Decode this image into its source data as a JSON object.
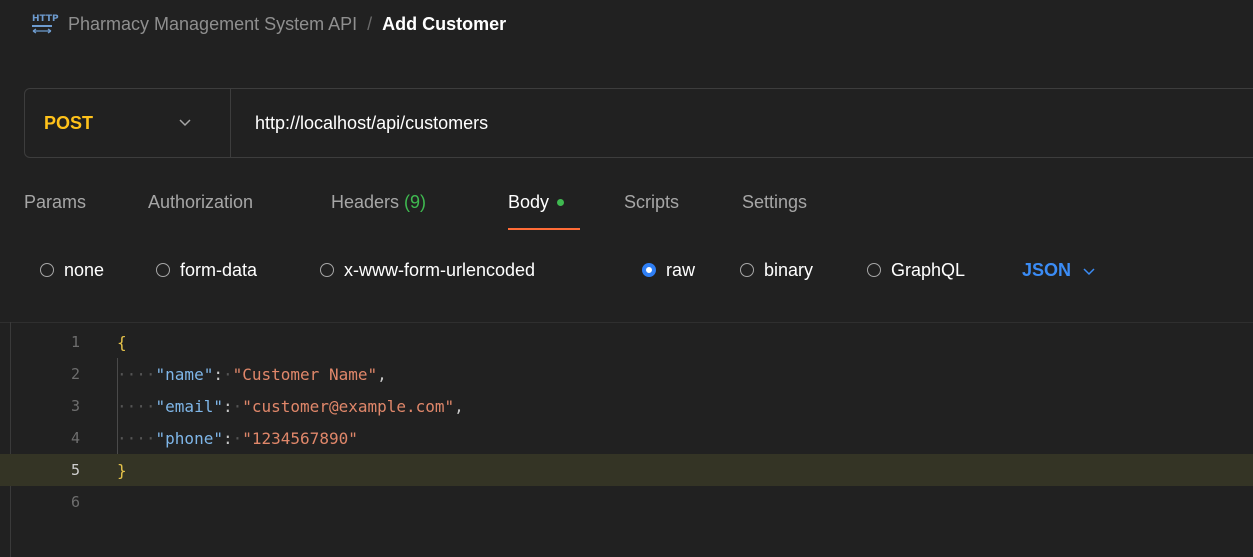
{
  "breadcrumb": {
    "icon": "http-icon",
    "icon_text": "HTTP",
    "parent": "Pharmacy Management System API",
    "separator": "/",
    "current": "Add Customer"
  },
  "request": {
    "method": "POST",
    "url": "http://localhost/api/customers"
  },
  "tabs": [
    {
      "label": "Params"
    },
    {
      "label": "Authorization"
    },
    {
      "label": "Headers",
      "count": "(9)"
    },
    {
      "label": "Body",
      "active": true
    },
    {
      "label": "Scripts"
    },
    {
      "label": "Settings"
    }
  ],
  "body_types": [
    {
      "label": "none"
    },
    {
      "label": "form-data"
    },
    {
      "label": "x-www-form-urlencoded"
    },
    {
      "label": "raw",
      "selected": true
    },
    {
      "label": "binary"
    },
    {
      "label": "GraphQL"
    }
  ],
  "language": "JSON",
  "editor": {
    "line_numbers": [
      "1",
      "2",
      "3",
      "4",
      "5",
      "6"
    ],
    "current_line": 5,
    "open_brace": "{",
    "close_brace": "}",
    "fields": [
      {
        "key": "\"name\"",
        "value": "\"Customer Name\"",
        "trailing": ","
      },
      {
        "key": "\"email\"",
        "value": "\"customer@example.com\"",
        "trailing": ","
      },
      {
        "key": "\"phone\"",
        "value": "\"1234567890\"",
        "trailing": ""
      }
    ]
  },
  "colors": {
    "method": "#ffc21a",
    "accent_underline": "#ff6c37",
    "indicator_green": "#3fb950",
    "radio_selected": "#2f7ff5",
    "json_key": "#7fb6e8",
    "json_string": "#e0876a"
  }
}
